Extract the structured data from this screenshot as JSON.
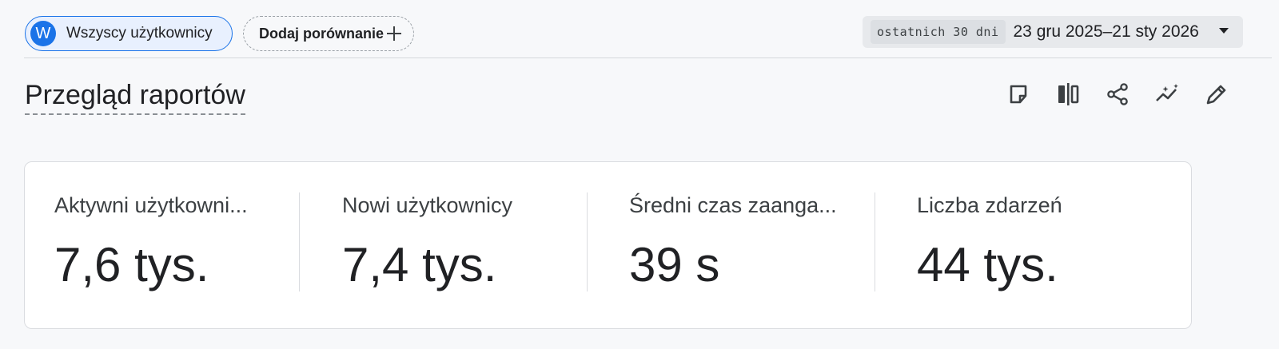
{
  "header": {
    "segment": {
      "avatar_letter": "W",
      "label": "Wszyscy użytkownicy",
      "color": "#1a73e8"
    },
    "compare": {
      "label": "Dodaj porównanie",
      "icon": "plus-icon"
    },
    "date_picker": {
      "range_badge": "ostatnich 30 dni",
      "range_value": "23 gru 2025–21 sty 2026",
      "icon": "dropdown-arrow-icon"
    }
  },
  "page": {
    "title": "Przegląd raportów"
  },
  "toolbar": {
    "icons": [
      "note-icon",
      "compare-columns-icon",
      "share-icon",
      "insights-icon",
      "edit-icon"
    ]
  },
  "metrics": [
    {
      "label": "Aktywni użytkowni...",
      "value": "7,6 tys."
    },
    {
      "label": "Nowi użytkownicy",
      "value": "7,4 tys."
    },
    {
      "label": "Średni czas zaanga...",
      "value": "39 s"
    },
    {
      "label": "Liczba zdarzeń",
      "value": "44 tys."
    }
  ]
}
